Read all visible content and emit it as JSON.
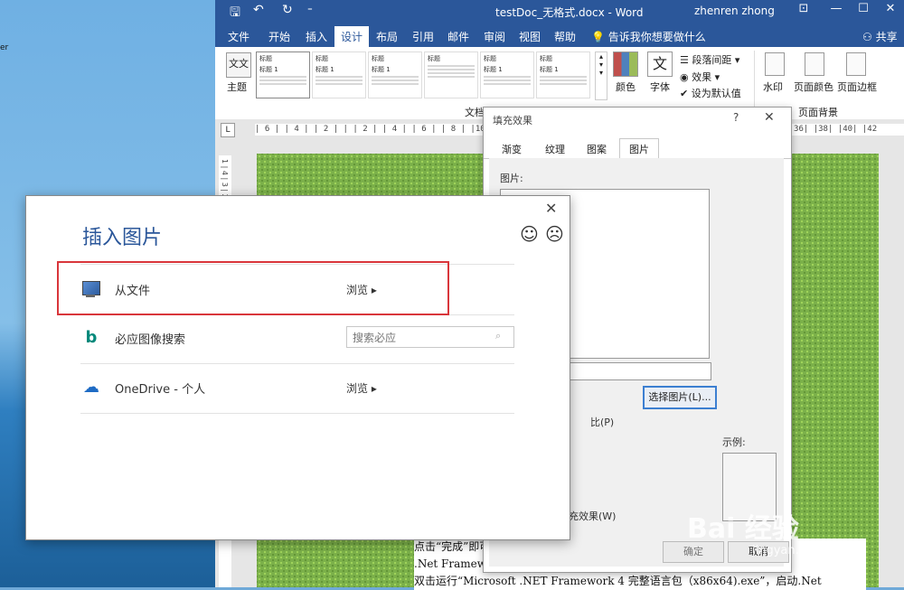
{
  "desktop": {
    "edge_glyph": "er"
  },
  "word": {
    "title": "testDoc_无格式.docx - Word",
    "user": "zhenren zhong",
    "quick_access": {
      "save": "🖫",
      "undo": "↶",
      "redo": "↻",
      "customize": "⁼"
    },
    "window_controls": {
      "ribbon_options": "⊡",
      "minimize": "—",
      "maximize": "☐",
      "close": "✕"
    },
    "tabs": [
      "文件",
      "开始",
      "插入",
      "设计",
      "布局",
      "引用",
      "邮件",
      "审阅",
      "视图",
      "帮助"
    ],
    "active_tab": "设计",
    "tell_me": "告诉我你想要做什么",
    "share": "共享",
    "ribbon": {
      "theme_label": "主题",
      "theme_box_text": "文文",
      "gallery_items": [
        {
          "title": "标题",
          "sub": "标题 1"
        },
        {
          "title": "标题",
          "sub": "标题 1"
        },
        {
          "title": "标题",
          "sub": "标题 1"
        },
        {
          "title": "标题",
          "sub": ""
        },
        {
          "title": "标题",
          "sub": "标题 1"
        },
        {
          "title": "标题",
          "sub": "标题 1"
        }
      ],
      "colors_label": "颜色",
      "fonts_label": "字体",
      "font_glyph": "文",
      "paragraph_spacing": "段落间距",
      "effects": "效果",
      "set_default": "设为默认值",
      "group_document_format": "文档格",
      "watermark": "水印",
      "page_color": "页面颜色",
      "page_borders": "页面边框",
      "group_page_background": "页面背景"
    },
    "ruler": {
      "corner": "L",
      "marks": "| 6 |  | 4 |  | 2 |  |    | 2 |  | 4 |  | 6 |  | 8 |  |10|  |12|  |14|  |16|  |18|  |20|  |22|  |24|  |26|  |28|  |30|  |32|  |34|  |36|  |38|  |40|  |42",
      "vertical_marks": "1 | 4 | 3 | 2 | 1 | 20 | 21 | 22"
    },
    "document_lines": [
      "点击“完成”即可。",
      ".Net Framework 汉化",
      "双击运行“Microsoft .NET Framework 4 完整语言包（x86x64).exe”，启动.Net"
    ]
  },
  "fill_effects": {
    "title": "填充效果",
    "help": "?",
    "close": "✕",
    "tabs": [
      "渐变",
      "纹理",
      "图案",
      "图片"
    ],
    "active_tab": "图片",
    "picture_label": "图片:",
    "choose_button": "选择图片(L)...",
    "lock_aspect_partial": "比(P)",
    "rotate_partial": "充效果(W)",
    "sample_label": "示例:",
    "ok": "确定",
    "cancel": "取消"
  },
  "insert_pictures": {
    "title": "插入图片",
    "close": "✕",
    "smile": "☺",
    "frown": "☹",
    "rows": [
      {
        "label": "从文件",
        "action": "浏览 ▸"
      },
      {
        "label": "必应图像搜索",
        "placeholder": "搜索必应",
        "search_icon": "⌕"
      },
      {
        "label": "OneDrive - 个人",
        "action": "浏览 ▸"
      }
    ],
    "icons": {
      "bing": "b",
      "cloud": "☁"
    }
  },
  "watermark": {
    "brand": "Bai 经验",
    "url": "jingyan.baidu.com"
  }
}
